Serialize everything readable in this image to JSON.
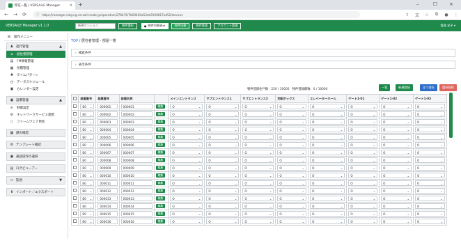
{
  "browser": {
    "tab_title": "所在一覧 | VERSAiLE Manager",
    "close_glyph": "×",
    "new_tab_glyph": "+",
    "minimize_glyph": "–",
    "maximize_glyph": "☐",
    "window_close_glyph": "×",
    "back_glyph": "←",
    "forward_glyph": "→",
    "reload_glyph": "⟳",
    "lock_glyph": "ⓘ",
    "url": "https://manager.vlag.ng.versail.mode.jp/operation/278476/7b59400a53de9109817ed52/devices",
    "icons": [
      "share-icon",
      "translate-icon",
      "bookmark-icon",
      "extensions-icon",
      "profile-icon",
      "menu-icon"
    ]
  },
  "header": {
    "app_title": "VERSAiLE Manager v1.1.0",
    "site_select": "新規マンション",
    "btn_change": "物件選択",
    "radio_label": "物件切替表示",
    "btn_active": "物件切替",
    "btn_master": "物件管理",
    "btn_account": "アカウント管理",
    "user": "管理 花子 ▾"
  },
  "sidebar": {
    "menu_label": "操作メニュー",
    "groups": [
      {
        "label": "進行管理",
        "items": [
          "居住者管理",
          "FM情報管理",
          "見積管理",
          "タイムパターン",
          "データスケジュール",
          "カレンダー設定"
        ]
      },
      {
        "label": "設備管理",
        "items": [
          "制御設定",
          "ネットワークサービス連携",
          "ファームウェア更新"
        ]
      },
      {
        "label": "鍵の確認",
        "items": []
      },
      {
        "label": "テンプレート確認",
        "items": []
      },
      {
        "label": "通話操作の選択",
        "items": []
      },
      {
        "label": "ログビューアー",
        "items": []
      },
      {
        "label": "監視",
        "items": []
      },
      {
        "label": "インポート／エクスポート",
        "items": []
      }
    ]
  },
  "main": {
    "breadcrumb_top": "TOP",
    "breadcrumb_rest": " / 居住者管理 - 部屋一覧",
    "cond1": "検索条件",
    "cond2": "表示条件",
    "summary": "物件登録住戸数：220 / 10000　物件登録鍵数：0 / 10000",
    "btn_list": "一覧",
    "btn_new": "新規登録",
    "btn_save": "全て保存",
    "btn_delete": "選択削除",
    "headers": [
      "",
      "部屋番号",
      "部屋番号",
      "部屋名称",
      "",
      "メインエントランス",
      "サブエントランス1",
      "サブエントランス2",
      "宅配ボックス",
      "エレベーターホール",
      "ゲート1-01",
      "ゲート1-02",
      "ゲート1-03"
    ],
    "edit_label": "編集",
    "select_value": "O",
    "floor_value": "B0",
    "rows": [
      {
        "no": "000001",
        "name": "000001"
      },
      {
        "no": "000002",
        "name": "000002"
      },
      {
        "no": "000003",
        "name": "000003"
      },
      {
        "no": "000004",
        "name": "000004"
      },
      {
        "no": "000005",
        "name": "000005"
      },
      {
        "no": "000006",
        "name": "000006"
      },
      {
        "no": "000007",
        "name": "000007"
      },
      {
        "no": "000008",
        "name": "000008"
      },
      {
        "no": "000009",
        "name": "000009"
      },
      {
        "no": "000010",
        "name": "000010"
      },
      {
        "no": "000011",
        "name": "000011"
      },
      {
        "no": "000012",
        "name": "000012"
      },
      {
        "no": "000013",
        "name": "000013"
      },
      {
        "no": "000014",
        "name": "000014"
      },
      {
        "no": "000015",
        "name": "000015"
      },
      {
        "no": "000016",
        "name": "000016"
      }
    ]
  },
  "colors": {
    "brand": "#1f8a4c",
    "save": "#2f6fc9",
    "delete": "#e0655f"
  }
}
